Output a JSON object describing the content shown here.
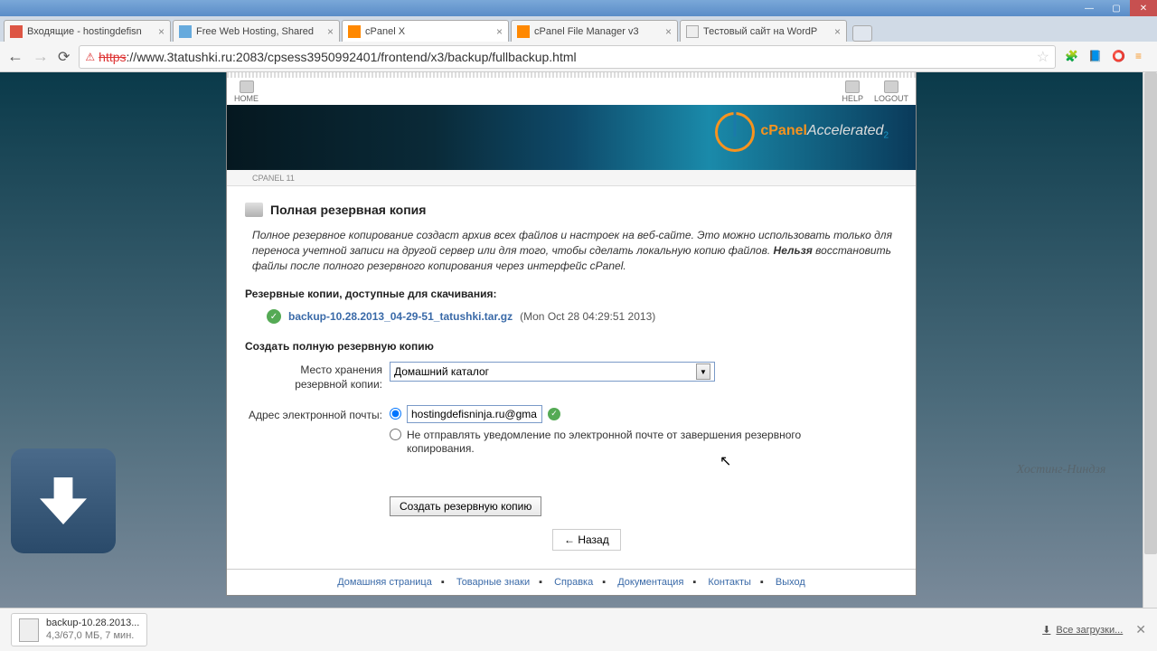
{
  "window": {
    "min": "—",
    "max": "▢",
    "close": "✕"
  },
  "tabs": [
    {
      "icon": "#d54",
      "label": "Входящие - hostingdefisn"
    },
    {
      "icon": "#6ad",
      "label": "Free Web Hosting, Shared"
    },
    {
      "icon": "#f80",
      "label": "cPanel X",
      "active": true
    },
    {
      "icon": "#f80",
      "label": "cPanel File Manager v3"
    },
    {
      "icon": "#8c8",
      "label": "Тестовый сайт на WordP"
    }
  ],
  "address": {
    "https": "https",
    "url": "://www.3tatushki.ru:2083/cpsess3950992401/frontend/x3/backup/fullbackup.html",
    "star": "☆"
  },
  "toolbar_ext": [
    "🧩",
    "📘",
    "⭕",
    "≡"
  ],
  "cpanel": {
    "home": "HOME",
    "help": "HELP",
    "logout": "LOGOUT",
    "logo_p1": "cPanel",
    "logo_p2": "Accelerated",
    "logo_p3": "2",
    "crumb": "CPANEL 11",
    "h1": "Полная резервная копия",
    "desc_1": "Полное резервное копирование создаст архив всех файлов и настроек на веб-сайте. Это можно использовать только для переноса учетной записи на другой сервер или для того, чтобы сделать локальную копию файлов. ",
    "desc_b": "Нельзя",
    "desc_2": " восстановить файлы после полного резервного копирования через интерфейс cPanel.",
    "h2a": "Резервные копии, доступные для скачивания:",
    "dl_link": "backup-10.28.2013_04-29-51_tatushki.tar.gz",
    "dl_date": "(Mon Oct 28 04:29:51 2013)",
    "h2b": "Создать полную резервную копию",
    "label_dest": "Место хранения резервной копии:",
    "dest_value": "Домашний каталог",
    "label_email": "Адрес электронной почты:",
    "email_value": "hostingdefisninja.ru@gma",
    "radio2": "Не отправлять уведомление по электронной почте от завершения резервного копирования.",
    "submit": "Создать резервную копию",
    "back": "← Назад",
    "footer": [
      "Домашняя страница",
      "Товарные знаки",
      "Справка",
      "Документация",
      "Контакты",
      "Выход"
    ]
  },
  "download": {
    "fname": "backup-10.28.2013...",
    "fprog": "4,3/67,0 МБ, 7 мин.",
    "all": "Все загрузки...",
    "close": "✕"
  },
  "watermark": "Хостинг-Ниндзя"
}
